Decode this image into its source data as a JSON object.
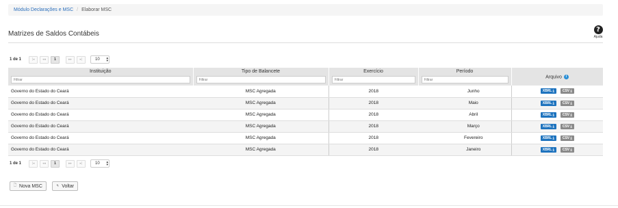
{
  "breadcrumb": {
    "parent": "Módulo Declarações e MSC",
    "separator": "/",
    "current": "Elaborar MSC"
  },
  "page": {
    "title": "Matrizes de Saldos Contábeis",
    "help_label": "Ajuda",
    "help_glyph": "?"
  },
  "pager_top": {
    "info": "1 de 1",
    "first": "|◂",
    "prev": "◂◂",
    "current_page": "1",
    "next": "▸▸",
    "last": "▸|",
    "page_size": "10"
  },
  "pager_bottom": {
    "info": "1 de 1",
    "first": "|◂",
    "prev": "◂◂",
    "current_page": "1",
    "next": "▸▸",
    "last": "▸|",
    "page_size": "10"
  },
  "table": {
    "headers": {
      "instituicao": "Instituição",
      "tipo": "Tipo de Balancete",
      "exercicio": "Exercício",
      "periodo": "Período",
      "arquivo": "Arquivo"
    },
    "filter_placeholder": "Filtrar",
    "rows": [
      {
        "instituicao": "Governo do Estado do Ceará",
        "tipo": "MSC Agregada",
        "exercicio": "2018",
        "periodo": "Junho",
        "xbrl": "XBRL ⤓",
        "csv": "CSV ⤓"
      },
      {
        "instituicao": "Governo do Estado do Ceará",
        "tipo": "MSC Agregada",
        "exercicio": "2018",
        "periodo": "Maio",
        "xbrl": "XBRL ⤓",
        "csv": "CSV ⤓"
      },
      {
        "instituicao": "Governo do Estado do Ceará",
        "tipo": "MSC Agregada",
        "exercicio": "2018",
        "periodo": "Abril",
        "xbrl": "XBRL ⤓",
        "csv": "CSV ⤓"
      },
      {
        "instituicao": "Governo do Estado do Ceará",
        "tipo": "MSC Agregada",
        "exercicio": "2018",
        "periodo": "Março",
        "xbrl": "XBRL ⤓",
        "csv": "CSV ⤓"
      },
      {
        "instituicao": "Governo do Estado do Ceará",
        "tipo": "MSC Agregada",
        "exercicio": "2018",
        "periodo": "Fevereiro",
        "xbrl": "XBRL ⤓",
        "csv": "CSV ⤓"
      },
      {
        "instituicao": "Governo do Estado do Ceará",
        "tipo": "MSC Agregada",
        "exercicio": "2018",
        "periodo": "Janeiro",
        "xbrl": "XBRL ⤓",
        "csv": "CSV ⤓"
      }
    ]
  },
  "actions": {
    "nova_msc": "Nova MSC",
    "voltar": "Voltar"
  },
  "colors": {
    "link": "#2a6ebb",
    "xbrl_button": "#1e73be",
    "csv_button": "#8a8a8a",
    "header_bg": "#e4e4e4",
    "info_icon": "#2a8fd6"
  },
  "icons": {
    "help": "question-circle-icon",
    "info": "info-circle-icon",
    "download": "download-icon",
    "new_document": "file-icon",
    "back": "undo-arrow-icon"
  }
}
